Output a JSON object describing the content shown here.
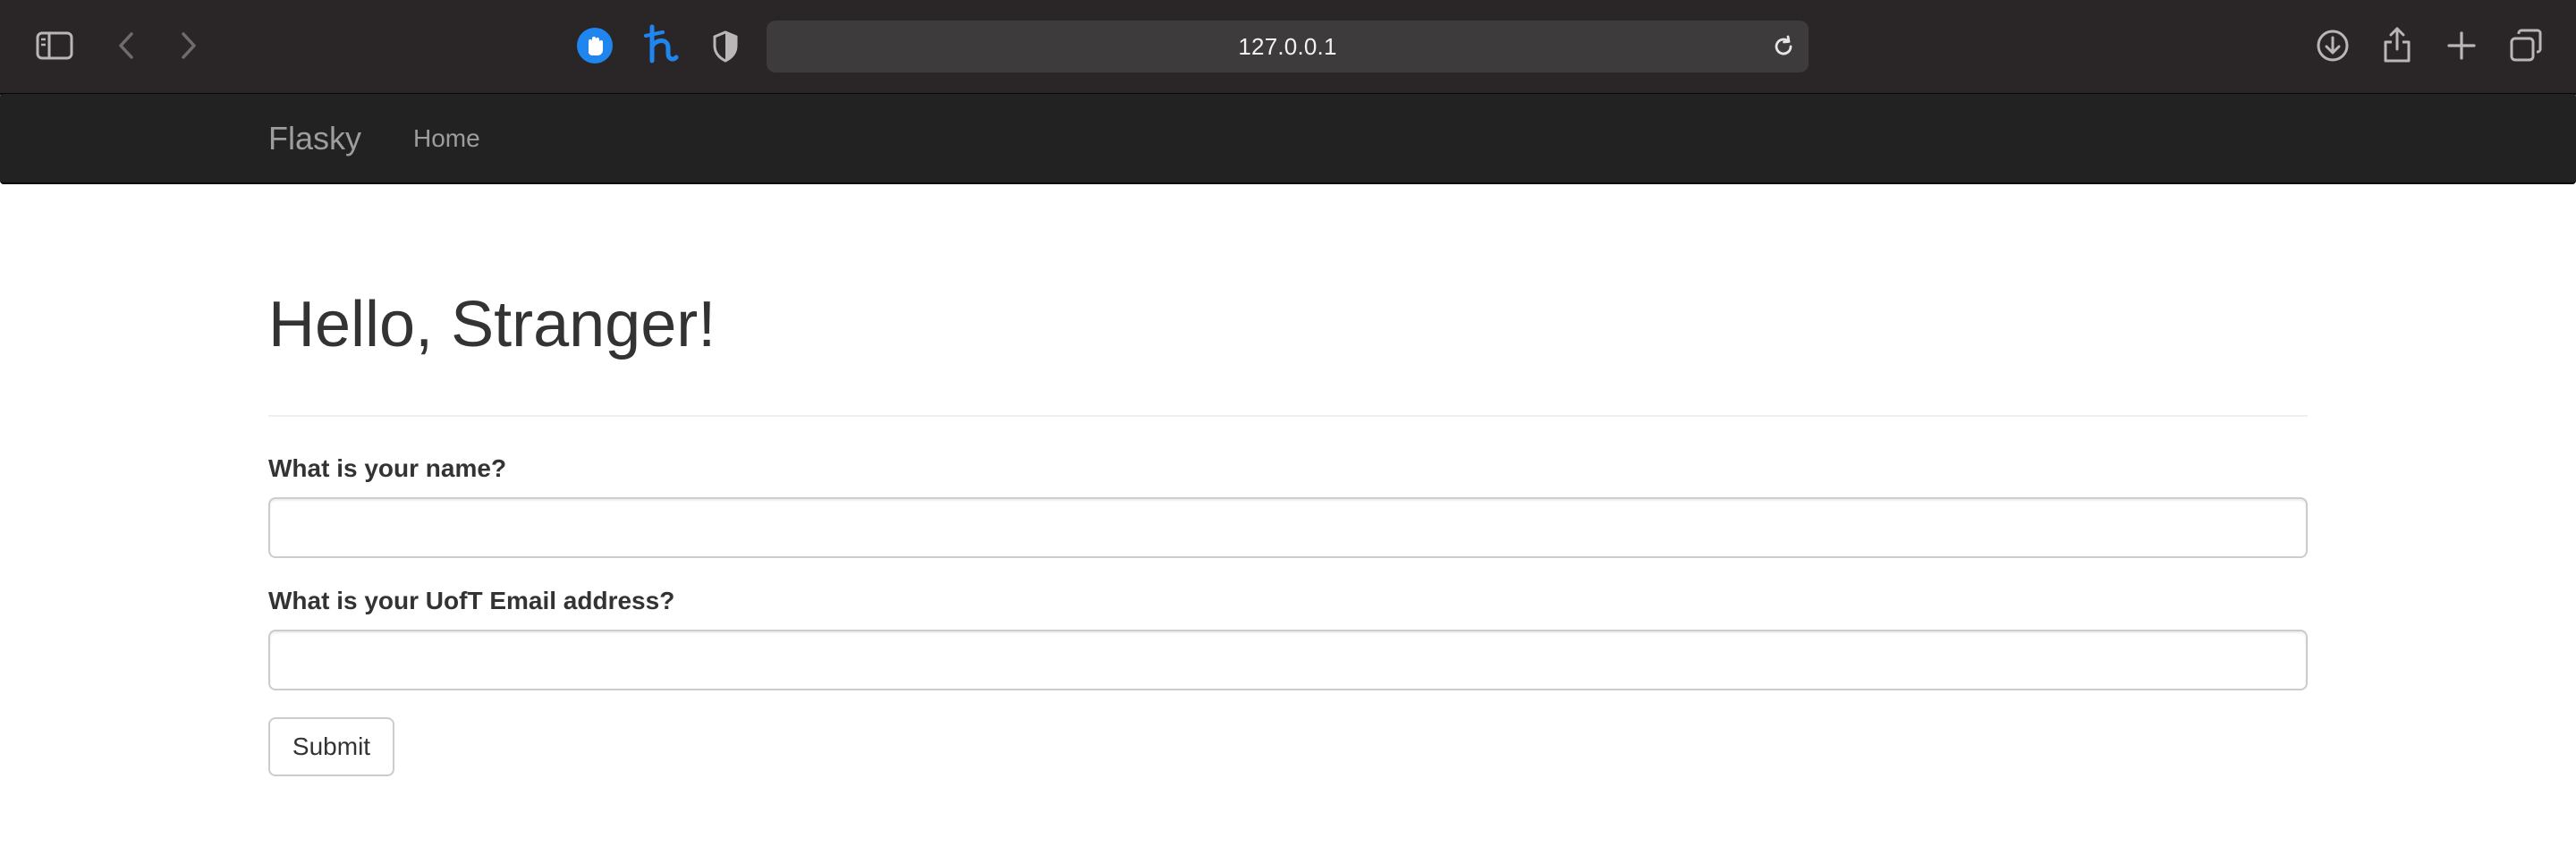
{
  "browser": {
    "url": "127.0.0.1",
    "icons": [
      "sidebar-icon",
      "back-arrow-icon",
      "forward-arrow-icon",
      "hand-extension-icon",
      "honey-extension-icon",
      "privacy-shield-icon",
      "reload-icon",
      "downloads-icon",
      "share-icon",
      "new-tab-icon",
      "tab-overview-icon"
    ],
    "colors": {
      "toolbar": "#2a2628",
      "address_bar": "#3e3b3d",
      "extension_blue": "#1f86f0"
    }
  },
  "navbar": {
    "brand": "Flasky",
    "links": [
      {
        "label": "Home"
      }
    ],
    "colors": {
      "background": "#222222",
      "text": "#9d9d9d"
    }
  },
  "main": {
    "title": "Hello, Stranger!",
    "form": {
      "name_label": "What is your name?",
      "name_value": "",
      "email_label": "What is your UofT Email address?",
      "email_value": "",
      "submit_label": "Submit"
    }
  }
}
